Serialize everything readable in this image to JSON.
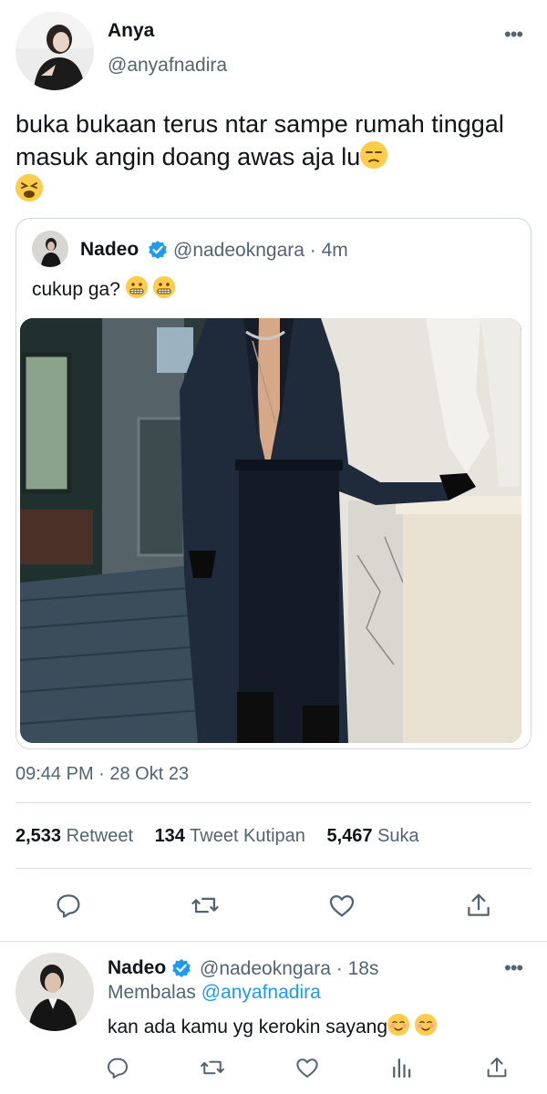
{
  "colors": {
    "accent": "#1d9bf0",
    "text": "#0f1419",
    "secondary": "#536471",
    "border": "#cfd9de"
  },
  "tweet": {
    "author_name": "Anya",
    "author_handle": "@anyafnadira",
    "more_label": "•••",
    "text": "buka bukaan terus ntar sampe rumah tinggal masuk angin doang awas aja lu",
    "emojis": [
      "unamused-face",
      "weary-face"
    ],
    "timestamp": "09:44 PM · 28 Okt 23",
    "stats": {
      "retweets": "2,533",
      "retweets_label": "Retweet",
      "quotes": "134",
      "quotes_label": "Tweet Kutipan",
      "likes": "5,467",
      "likes_label": "Suka"
    },
    "actions": [
      "reply-icon",
      "retweet-icon",
      "like-icon",
      "share-icon"
    ]
  },
  "quoted": {
    "author_name": "Nadeo",
    "verified": true,
    "author_handle": "@nadeokngara · 4m",
    "text": "cukup ga?",
    "emojis": [
      "grimacing-face",
      "grimacing-face"
    ],
    "media": "photo"
  },
  "reply": {
    "author_name": "Nadeo",
    "verified": true,
    "author_handle": "@nadeokngara · 18s",
    "more_label": "•••",
    "replying_prefix": "Membalas",
    "replying_to": "@anyafnadira",
    "text": "kan ada kamu yg kerokin sayang",
    "emojis": [
      "smiling-face",
      "smiling-face"
    ],
    "actions": [
      "reply-icon",
      "retweet-icon",
      "like-icon",
      "analytics-icon",
      "share-icon"
    ]
  }
}
